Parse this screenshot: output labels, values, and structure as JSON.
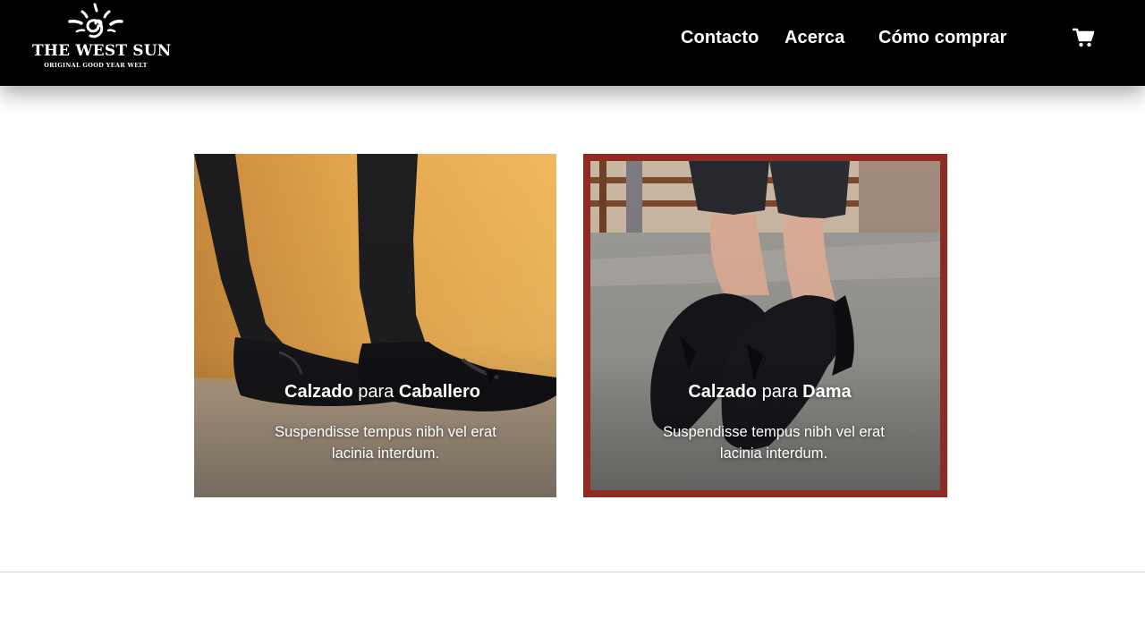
{
  "brand": {
    "name": "THE WEST SUN",
    "tagline": "ORIGINAL GOOD YEAR WELT"
  },
  "nav": {
    "items": [
      {
        "label": "Contacto"
      },
      {
        "label": "Acerca"
      },
      {
        "label": "Cómo comprar"
      }
    ],
    "cart_icon": "shopping-cart-icon"
  },
  "cards": [
    {
      "title_strong_1": "Calzado",
      "title_light": "para",
      "title_strong_2": "Caballero",
      "description": "Suspendisse tempus nibh vel erat lacinia interdum."
    },
    {
      "title_strong_1": "Calzado",
      "title_light": "para",
      "title_strong_2": "Dama",
      "description": "Suspendisse tempus nibh vel erat lacinia interdum."
    }
  ],
  "colors": {
    "header_bg": "#000000",
    "accent_border": "#8e2b23",
    "text_light": "#ffffff"
  }
}
